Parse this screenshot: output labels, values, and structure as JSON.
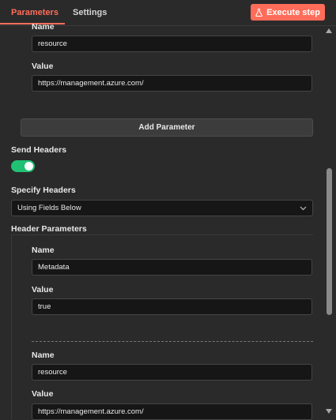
{
  "tabs": {
    "parameters": "Parameters",
    "settings": "Settings"
  },
  "execute_button": "Execute step",
  "query_param": {
    "name_label": "Name",
    "name_value": "resource",
    "value_label": "Value",
    "value_value": "https://management.azure.com/"
  },
  "add_parameter": "Add Parameter",
  "send_headers": {
    "label": "Send Headers",
    "enabled": true
  },
  "specify_headers": {
    "label": "Specify Headers",
    "selected": "Using Fields Below"
  },
  "header_parameters": {
    "label": "Header Parameters",
    "items": [
      {
        "name_label": "Name",
        "name_value": "Metadata",
        "value_label": "Value",
        "value_value": "true"
      },
      {
        "name_label": "Name",
        "name_value": "resource",
        "value_label": "Value",
        "value_value": "https://management.azure.com/"
      }
    ]
  },
  "colors": {
    "accent": "#ff6d5a",
    "toggle_on": "#21c175",
    "background": "#2a2a2a"
  }
}
